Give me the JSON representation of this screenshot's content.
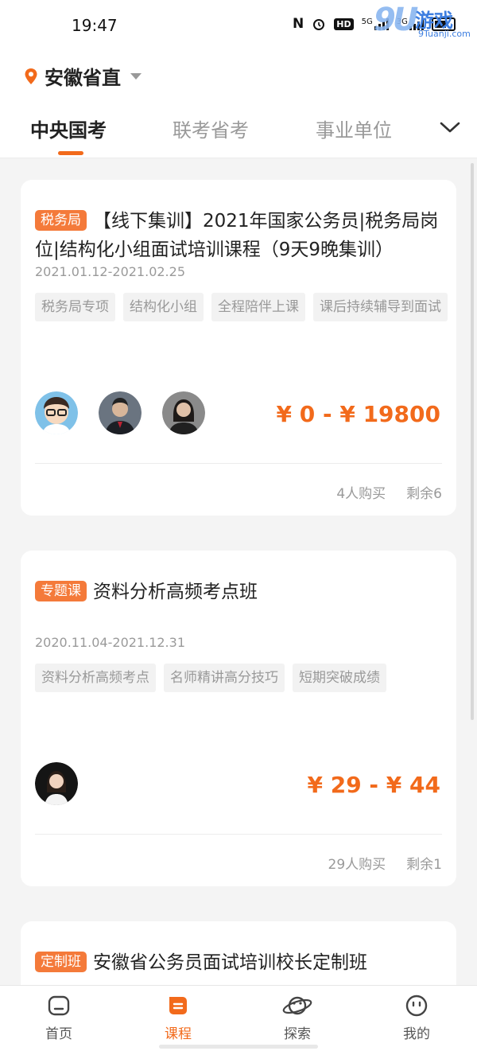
{
  "status": {
    "time": "19:47",
    "icons": [
      "nfc-icon",
      "alarm-icon",
      "hd-icon",
      "signal-5g-icon",
      "signal-3g-icon",
      "battery-icon"
    ],
    "hd": "HD",
    "net1": "5G",
    "net2": "3G"
  },
  "watermark": {
    "num": "9U",
    "text": "游戏",
    "url": "9Tuanji.com"
  },
  "location": {
    "name": "安徽省直"
  },
  "tabs": [
    {
      "label": "中央国考",
      "active": true
    },
    {
      "label": "联考省考",
      "active": false
    },
    {
      "label": "事业单位",
      "active": false
    }
  ],
  "courses": [
    {
      "badge": "税务局",
      "title": "【线下集训】2021年国家公务员|税务局岗位|结构化小组面试培训课程（9天9晚集训）",
      "date": "2021.01.12-2021.02.25",
      "tags": [
        "税务局专项",
        "结构化小组",
        "全程陪伴上课",
        "课后持续辅导到面试"
      ],
      "price": "¥ 0 - ¥ 19800",
      "buyers": "4人购买",
      "remaining": "剩余6"
    },
    {
      "badge": "专题课",
      "title": "资料分析高频考点班",
      "date": "2020.11.04-2021.12.31",
      "tags": [
        "资料分析高频考点",
        "名师精讲高分技巧",
        "短期突破成绩"
      ],
      "price": "¥ 29 - ¥ 44",
      "buyers": "29人购买",
      "remaining": "剩余1"
    },
    {
      "badge": "定制班",
      "title": "安徽省公务员面试培训校长定制班"
    }
  ],
  "tabbar": [
    {
      "label": "首页",
      "icon": "home-icon"
    },
    {
      "label": "课程",
      "icon": "course-icon",
      "active": true
    },
    {
      "label": "探索",
      "icon": "planet-icon"
    },
    {
      "label": "我的",
      "icon": "profile-icon"
    }
  ],
  "colors": {
    "accent": "#f26a1b",
    "badge": "#f47a3a",
    "background": "#f4f4f4"
  }
}
